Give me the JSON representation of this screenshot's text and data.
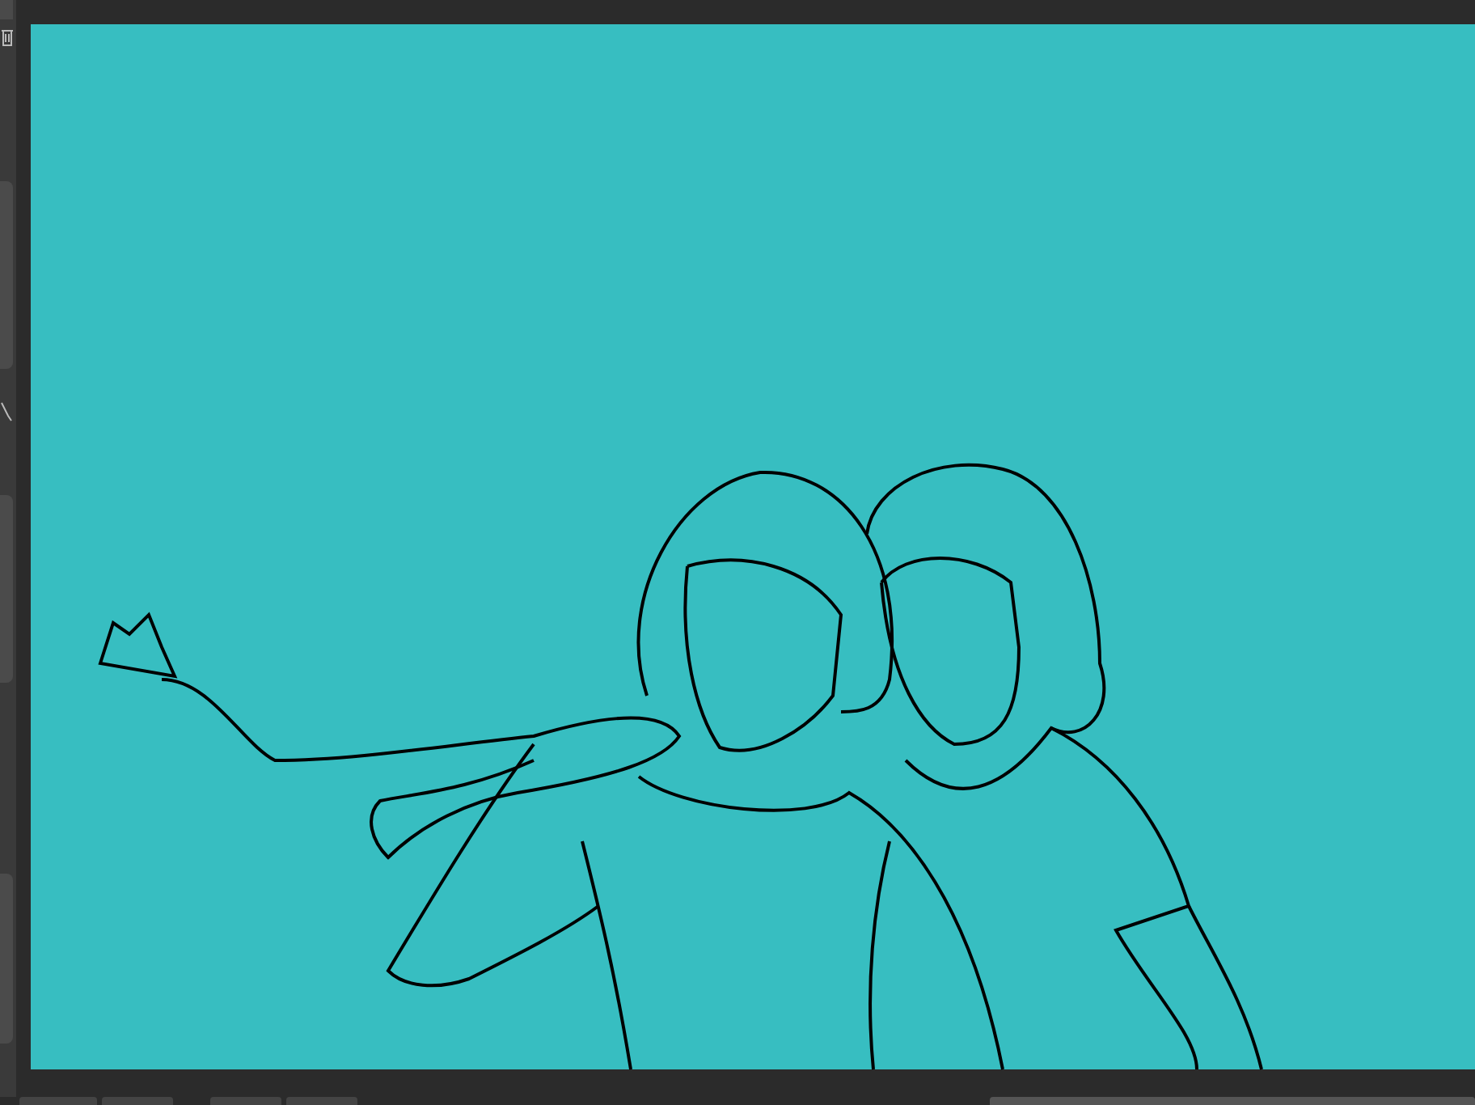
{
  "canvas": {
    "kind": "line-art"
  }
}
